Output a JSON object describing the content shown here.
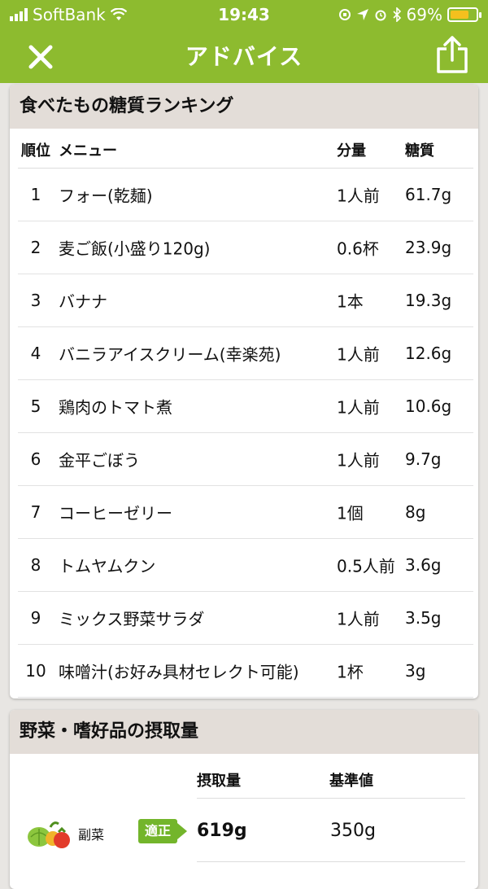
{
  "status": {
    "carrier": "SoftBank",
    "time": "19:43",
    "battery": "69%",
    "battery_level": 0.69
  },
  "nav": {
    "title": "アドバイス",
    "close_icon": "close-icon",
    "share_icon": "share-icon"
  },
  "ranking": {
    "title": "食べたもの糖質ランキング",
    "headers": {
      "pos": "順位",
      "menu": "メニュー",
      "amount": "分量",
      "carb": "糖質"
    },
    "rows": [
      {
        "pos": "1",
        "menu": "フォー(乾麺)",
        "amount": "1人前",
        "carb": "61.7g"
      },
      {
        "pos": "2",
        "menu": "麦ご飯(小盛り120g)",
        "amount": "0.6杯",
        "carb": "23.9g"
      },
      {
        "pos": "3",
        "menu": "バナナ",
        "amount": "1本",
        "carb": "19.3g"
      },
      {
        "pos": "4",
        "menu": "バニラアイスクリーム(幸楽苑)",
        "amount": "1人前",
        "carb": "12.6g"
      },
      {
        "pos": "5",
        "menu": "鶏肉のトマト煮",
        "amount": "1人前",
        "carb": "10.6g"
      },
      {
        "pos": "6",
        "menu": "金平ごぼう",
        "amount": "1人前",
        "carb": "9.7g"
      },
      {
        "pos": "7",
        "menu": "コーヒーゼリー",
        "amount": "1個",
        "carb": "8g"
      },
      {
        "pos": "8",
        "menu": "トムヤムクン",
        "amount": "0.5人前",
        "carb": "3.6g"
      },
      {
        "pos": "9",
        "menu": "ミックス野菜サラダ",
        "amount": "1人前",
        "carb": "3.5g"
      },
      {
        "pos": "10",
        "menu": "味噌汁(お好み具材セレクト可能)",
        "amount": "1杯",
        "carb": "3g"
      }
    ]
  },
  "intake": {
    "title": "野菜・嗜好品の摂取量",
    "headers": {
      "amount": "摂取量",
      "standard": "基準値"
    },
    "rows": [
      {
        "label": "副菜",
        "badge": "適正",
        "value": "619g",
        "standard": "350g",
        "icon": "vegetables-icon",
        "badge_color": "#73b52b"
      }
    ]
  }
}
